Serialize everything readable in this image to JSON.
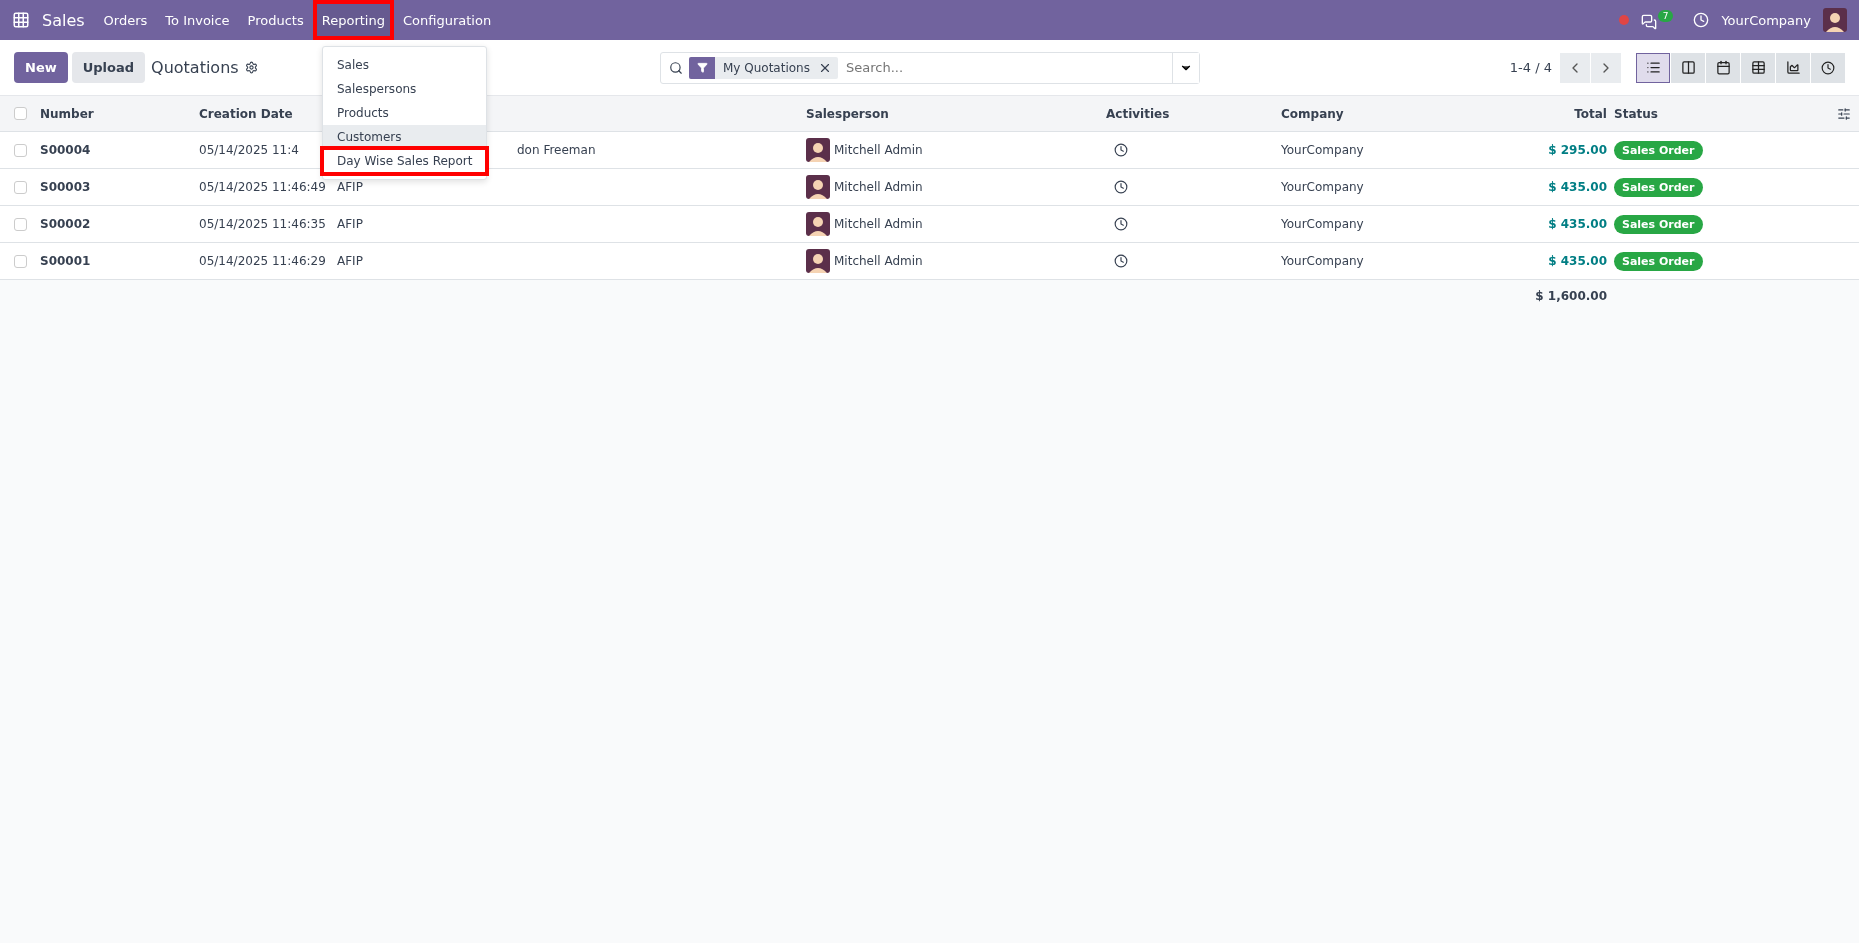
{
  "navbar": {
    "app_name": "Sales",
    "menus": [
      {
        "label": "Orders",
        "open": false,
        "highlighted": false
      },
      {
        "label": "To Invoice",
        "open": false,
        "highlighted": false
      },
      {
        "label": "Products",
        "open": false,
        "highlighted": false
      },
      {
        "label": "Reporting",
        "open": true,
        "highlighted": true
      },
      {
        "label": "Configuration",
        "open": false,
        "highlighted": false
      }
    ],
    "message_count": "7",
    "company": "YourCompany"
  },
  "dropdown": {
    "items": [
      {
        "label": "Sales",
        "hovered": false,
        "highlighted": false
      },
      {
        "label": "Salespersons",
        "hovered": false,
        "highlighted": false
      },
      {
        "label": "Products",
        "hovered": false,
        "highlighted": false
      },
      {
        "label": "Customers",
        "hovered": true,
        "highlighted": false
      },
      {
        "label": "Day Wise Sales Report",
        "hovered": false,
        "highlighted": true
      }
    ]
  },
  "control_panel": {
    "buttons": [
      "New",
      "Upload"
    ],
    "title": "Quotations",
    "filter": "My Quotations",
    "search_placeholder": "Search...",
    "pager": "1-4 / 4",
    "views": [
      {
        "kind": "list",
        "selected": true
      },
      {
        "kind": "kanban",
        "selected": false
      },
      {
        "kind": "calendar",
        "selected": false
      },
      {
        "kind": "pivot",
        "selected": false
      },
      {
        "kind": "graph",
        "selected": false
      },
      {
        "kind": "activity",
        "selected": false
      }
    ]
  },
  "table": {
    "all_checked": false,
    "columns": [
      "Number",
      "Creation Date",
      "Salesperson",
      "Activities",
      "Company",
      "Total",
      "Status"
    ],
    "rows": [
      {
        "number": "S00004",
        "date": "05/14/2025 11:4",
        "customer": "don Freeman",
        "customer_covered": true,
        "salesperson": "Mitchell Admin",
        "company": "YourCompany",
        "total": "$ 295.00",
        "status": "Sales Order",
        "checked": false
      },
      {
        "number": "S00003",
        "date": "05/14/2025 11:46:49",
        "customer": "AFIP",
        "salesperson": "Mitchell Admin",
        "company": "YourCompany",
        "total": "$ 435.00",
        "status": "Sales Order",
        "checked": false
      },
      {
        "number": "S00002",
        "date": "05/14/2025 11:46:35",
        "customer": "AFIP",
        "salesperson": "Mitchell Admin",
        "company": "YourCompany",
        "total": "$ 435.00",
        "status": "Sales Order",
        "checked": false
      },
      {
        "number": "S00001",
        "date": "05/14/2025 11:46:29",
        "customer": "AFIP",
        "salesperson": "Mitchell Admin",
        "company": "YourCompany",
        "total": "$ 435.00",
        "status": "Sales Order",
        "checked": false
      }
    ],
    "grand_total": "$ 1,600.00"
  }
}
